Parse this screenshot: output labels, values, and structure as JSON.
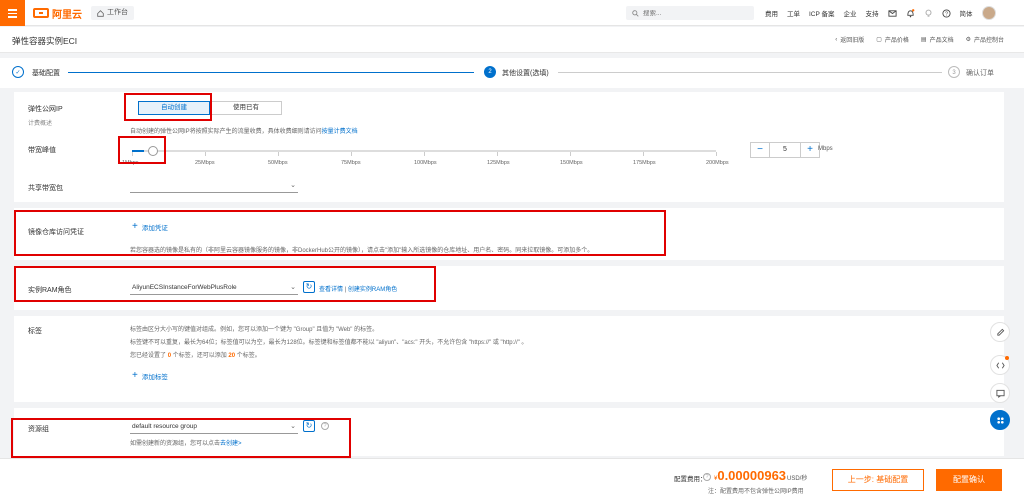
{
  "topbar": {
    "logo_text": "阿里云",
    "workbench": "工作台",
    "search_placeholder": "搜索...",
    "links": [
      "费用",
      "工单",
      "ICP 备案",
      "企业",
      "支持"
    ],
    "lang": "简体",
    "accent_color": "#ff6a00"
  },
  "header": {
    "title": "弹性容器实例ECI",
    "links": [
      "返回旧版",
      "产品价格",
      "产品文档",
      "产品控制台"
    ]
  },
  "steps": [
    {
      "num": "✓",
      "label": "基础配置",
      "state": "done"
    },
    {
      "num": "2",
      "label": "其他设置(选填)",
      "state": "active"
    },
    {
      "num": "3",
      "label": "确认订单",
      "state": "todo"
    }
  ],
  "eip": {
    "label": "弹性公网IP",
    "sublabel": "计费概述",
    "options": [
      "自动创建",
      "使用已有"
    ],
    "selected": "自动创建",
    "hint_prefix": "自动创建的弹性公网IP将按照实际产生的流量收费，具体收费细则请访问",
    "hint_link": "按量计费文档"
  },
  "bandwidth": {
    "label": "带宽峰值",
    "ticks": [
      "1Mbps",
      "25Mbps",
      "50Mbps",
      "75Mbps",
      "100Mbps",
      "125Mbps",
      "150Mbps",
      "175Mbps",
      "200Mbps"
    ],
    "min": 1,
    "max": 200,
    "value": "5",
    "minus": "−",
    "plus": "+",
    "unit": "Mbps"
  },
  "shared_bw": {
    "label": "共享带宽包",
    "value": ""
  },
  "registry": {
    "label": "镜像仓库访问凭证",
    "add_label": "添加凭证",
    "hint": "若您容器选的镜像是私有的（非阿里云容器镜像服务的镜像，非DockerHub公开的镜像），请点击\"添加\"输入所选镜像的仓库地址、用户名、密码。同来拉取镜像。可添加多个。"
  },
  "ram": {
    "label": "实例RAM角色",
    "value": "AliyunECSInstanceForWebPlusRole",
    "link_view": "查看详情",
    "separator": "|",
    "link_create": "创建实例RAM角色"
  },
  "tags": {
    "label": "标签",
    "line1": "标签由区分大小写的键值对组成。例如，您可以添加一个键为 \"Group\" 且值为 \"Web\" 的标签。",
    "line2": "标签键不可以重复，最长为64位；标签值可以为空，最长为128位。标签键和标签值都不能以 \"aliyun\"、\"acs:\" 开头，不允许包含 \"https://\" 或 \"http://\" 。",
    "line3_a": "您已经设置了",
    "line3_count": "0",
    "line3_b": "个标签，还可以添加",
    "line3_remain": "20",
    "line3_c": "个标签。",
    "add_label": "添加标签"
  },
  "resource_group": {
    "label": "资源组",
    "value": "default resource group",
    "hint_prefix": "如需创建新的资源组，您可以点击",
    "hint_link": "去创建>"
  },
  "footer": {
    "fee_label": "配置费用：",
    "currency": "¥",
    "price": "0.00000963",
    "unit": "USD/秒",
    "note": "注：配置费用不包含弹性公网IP费用",
    "prev": "上一步: 基础配置",
    "next": "配置确认"
  }
}
